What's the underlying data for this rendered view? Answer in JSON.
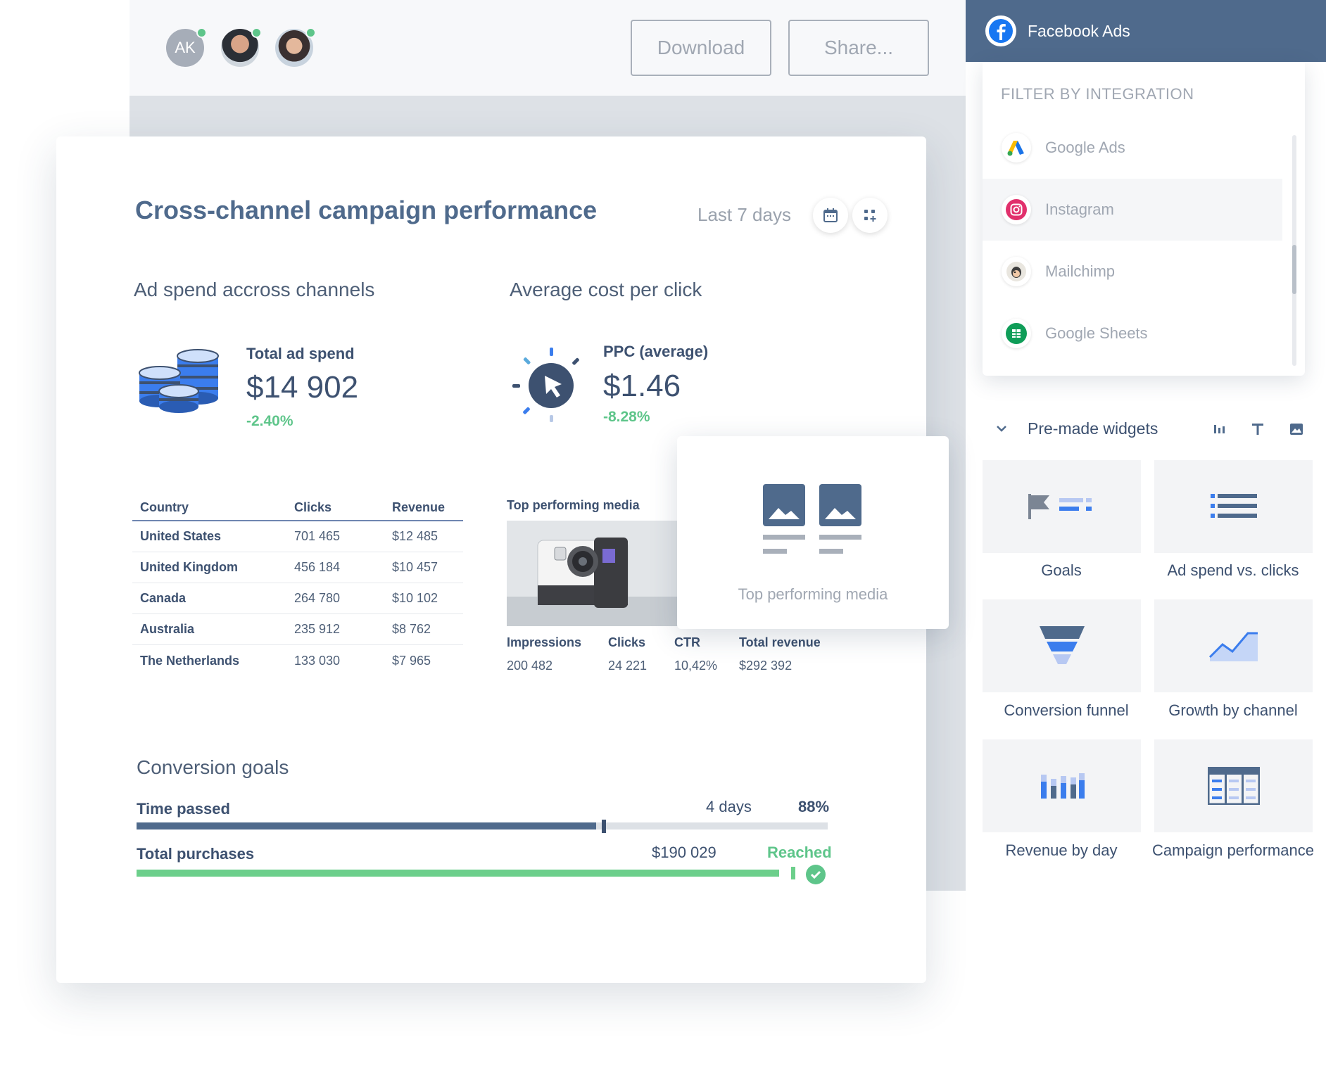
{
  "toolbar": {
    "avatar_initials": "AK",
    "download_label": "Download",
    "share_label": "Share..."
  },
  "report": {
    "title": "Cross-channel campaign performance",
    "date_range": "Last 7 days"
  },
  "ad_spend": {
    "title": "Ad spend accross channels",
    "label": "Total ad spend",
    "value": "$14 902",
    "change": "-2.40%"
  },
  "cpc": {
    "title": "Average cost per click",
    "label": "PPC (average)",
    "value": "$1.46",
    "change": "-8.28%"
  },
  "country_table": {
    "headers": [
      "Country",
      "Clicks",
      "Revenue"
    ],
    "rows": [
      [
        "United States",
        "701 465",
        "$12 485"
      ],
      [
        "United Kingdom",
        "456 184",
        "$10 457"
      ],
      [
        "Canada",
        "264 780",
        "$10 102"
      ],
      [
        "Australia",
        "235 912",
        "$8 762"
      ],
      [
        "The Netherlands",
        "133 030",
        "$7 965"
      ]
    ]
  },
  "media": {
    "title": "Top performing media",
    "stats": [
      {
        "label": "Impressions",
        "value": "200 482"
      },
      {
        "label": "Clicks",
        "value": "24 221"
      },
      {
        "label": "CTR",
        "value": "10,42%"
      },
      {
        "label": "Total revenue",
        "value": "$292 392"
      }
    ]
  },
  "floating_widget": {
    "label": "Top performing media"
  },
  "goals": {
    "title": "Conversion goals",
    "time_passed": {
      "label": "Time passed",
      "value": "4 days",
      "percent": "88%",
      "progress": 0.665
    },
    "purchases": {
      "label": "Total purchases",
      "value": "$190 029",
      "status": "Reached",
      "progress": 0.93
    }
  },
  "panel": {
    "header_title": "Facebook Ads",
    "filter_title": "FILTER BY INTEGRATION",
    "integrations": [
      "Google Ads",
      "Instagram",
      "Mailchimp",
      "Google Sheets"
    ],
    "premade_title": "Pre-made widgets",
    "widgets": [
      "Goals",
      "Ad spend vs. clicks",
      "Conversion funnel",
      "Growth by channel",
      "Revenue by day",
      "Campaign performance"
    ]
  },
  "colors": {
    "primary": "#4f6a8c",
    "accent_blue": "#3b7ded",
    "positive": "#5ec58a",
    "muted_text": "#a0a7b2"
  }
}
